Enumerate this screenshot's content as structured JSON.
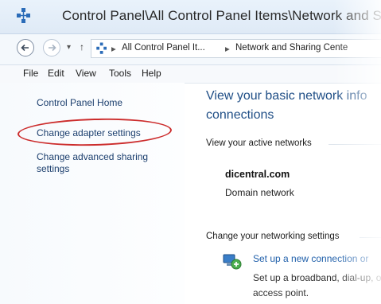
{
  "window": {
    "title": "Control Panel\\All Control Panel Items\\Network and Sh"
  },
  "address_bar": {
    "segments": [
      "All Control Panel It...",
      "Network and Sharing Cente"
    ],
    "separator": "▸",
    "recent_glyph": "▾",
    "up_glyph": "↑"
  },
  "menu": {
    "items": [
      "File",
      "Edit",
      "View",
      "Tools",
      "Help"
    ]
  },
  "sidebar": {
    "home": "Control Panel Home",
    "adapter": "Change adapter settings",
    "advanced": "Change advanced sharing settings"
  },
  "main": {
    "heading": "View your basic network info connections",
    "active_networks_label": "View your active networks",
    "network_name": "dicentral.com",
    "network_type": "Domain network",
    "change_settings_label": "Change your networking settings",
    "setup_link": "Set up a new connection or",
    "setup_desc": "Set up a broadband, dial-up, or access point."
  },
  "colors": {
    "highlight": "#cc2c2c",
    "link": "#1f5faa",
    "heading": "#1f4e86"
  },
  "icons": {
    "title": "network-icon",
    "back": "back-arrow-icon",
    "forward": "forward-arrow-icon",
    "setup": "network-setup-icon"
  }
}
